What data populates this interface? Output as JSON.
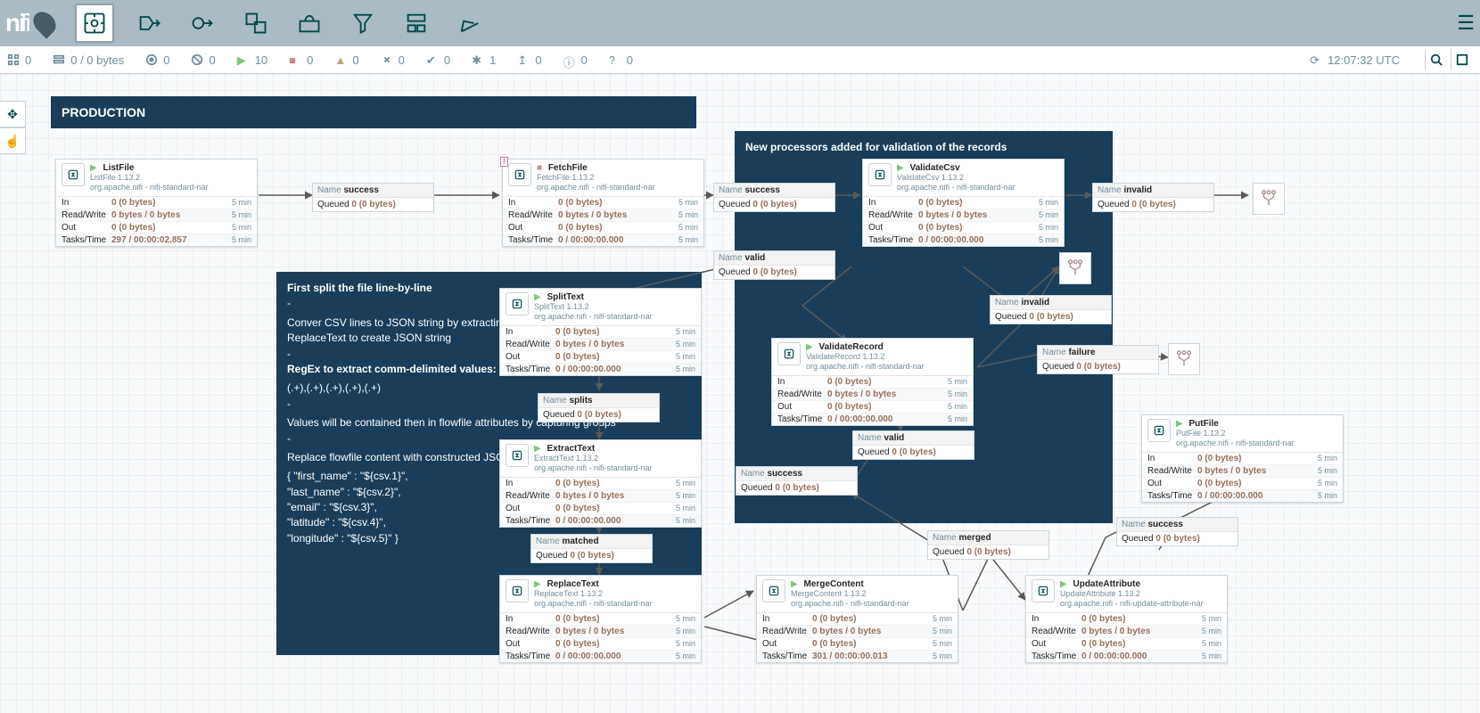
{
  "app": {
    "logo": "ni",
    "logo2": "fi"
  },
  "status": {
    "threads": "0",
    "queued": "0 / 0 bytes",
    "tx_in": "0",
    "tx_out": "0",
    "running": "10",
    "stopped": "0",
    "invalid": "0",
    "disabled": "0",
    "uptodate": "0",
    "stale": "1",
    "sync": "0",
    "info": "0",
    "unknown": "0",
    "clock": "12:07:32 UTC"
  },
  "groups": {
    "production": "PRODUCTION",
    "validation_title": "New processors added for validation of the records",
    "split_title": "First split the file line-by-line",
    "split_body1": "Conver CSV lines to JSON string by extracting CSV values using RegEx and then ReplaceText to create JSON string",
    "split_body2": "RegEx to extract comm-delimited values:",
    "split_regex": "(.+),(.+),(.+),(.+),(.+)",
    "split_body3": "Values will be contained then in flowfile attributes by capturing groups",
    "split_body4": "Replace flowfile content with constructed JSON string and attributes values",
    "split_json": "{ \"first_name\" : \"${csv.1}\",\n\"last_name\" : \"${csv.2}\",\n\"email\" : \"${csv.3}\",\n\"latitude\" : \"${csv.4}\",\n\"longitude\" : \"${csv.5}\" }"
  },
  "five_min": "5 min",
  "queued_zero": "0 (0 bytes)",
  "proc": {
    "listfile": {
      "name": "ListFile",
      "type": "ListFile 1.13.2",
      "bundle": "org.apache.nifi - nifi-standard-nar",
      "state": "run",
      "in": "0 (0 bytes)",
      "rw": "0 bytes / 0 bytes",
      "out": "0 (0 bytes)",
      "tt": "297 / 00:00:02.857"
    },
    "fetchfile": {
      "name": "FetchFile",
      "type": "FetchFile 1.13.2",
      "bundle": "org.apache.nifi - nifi-standard-nar",
      "state": "stop",
      "in": "0 (0 bytes)",
      "rw": "0 bytes / 0 bytes",
      "out": "0 (0 bytes)",
      "tt": "0 / 00:00:00.000"
    },
    "validatecsv": {
      "name": "ValidateCsv",
      "type": "ValidateCsv 1.13.2",
      "bundle": "org.apache.nifi - nifi-standard-nar",
      "state": "run",
      "in": "0 (0 bytes)",
      "rw": "0 bytes / 0 bytes",
      "out": "0 (0 bytes)",
      "tt": "0 / 00:00:00.000"
    },
    "splittext": {
      "name": "SplitText",
      "type": "SplitText 1.13.2",
      "bundle": "org.apache.nifi - nifi-standard-nar",
      "state": "run",
      "in": "0 (0 bytes)",
      "rw": "0 bytes / 0 bytes",
      "out": "0 (0 bytes)",
      "tt": "0 / 00:00:00.000"
    },
    "extracttext": {
      "name": "ExtractText",
      "type": "ExtractText 1.13.2",
      "bundle": "org.apache.nifi - nifi-standard-nar",
      "state": "run",
      "in": "0 (0 bytes)",
      "rw": "0 bytes / 0 bytes",
      "out": "0 (0 bytes)",
      "tt": "0 / 00:00:00.000"
    },
    "replacetext": {
      "name": "ReplaceText",
      "type": "ReplaceText 1.13.2",
      "bundle": "org.apache.nifi - nifi-standard-nar",
      "state": "run",
      "in": "0 (0 bytes)",
      "rw": "0 bytes / 0 bytes",
      "out": "0 (0 bytes)",
      "tt": "0 / 00:00:00.000"
    },
    "validaterec": {
      "name": "ValidateRecord",
      "type": "ValidateRecord 1.13.2",
      "bundle": "org.apache.nifi - nifi-standard-nar",
      "state": "run",
      "in": "0 (0 bytes)",
      "rw": "0 bytes / 0 bytes",
      "out": "0 (0 bytes)",
      "tt": "0 / 00:00:00.000"
    },
    "mergecontent": {
      "name": "MergeContent",
      "type": "MergeContent 1.13.2",
      "bundle": "org.apache.nifi - nifi-standard-nar",
      "state": "run",
      "in": "0 (0 bytes)",
      "rw": "0 bytes / 0 bytes",
      "out": "0 (0 bytes)",
      "tt": "301 / 00:00:00.013"
    },
    "updateattr": {
      "name": "UpdateAttribute",
      "type": "UpdateAttribute 1.13.2",
      "bundle": "org.apache.nifi - nifi-update-attribute-nar",
      "state": "run",
      "in": "0 (0 bytes)",
      "rw": "0 bytes / 0 bytes",
      "out": "0 (0 bytes)",
      "tt": "0 / 00:00:00.000"
    },
    "putfile": {
      "name": "PutFile",
      "type": "PutFile 1.13.2",
      "bundle": "org.apache.nifi - nifi-standard-nar",
      "state": "run",
      "in": "0 (0 bytes)",
      "rw": "0 bytes / 0 bytes",
      "out": "0 (0 bytes)",
      "tt": "0 / 00:00:00.000"
    }
  },
  "conn": {
    "success": "success",
    "splits": "splits",
    "matched": "matched",
    "valid": "valid",
    "invalid": "invalid",
    "failure": "failure",
    "merged": "merged",
    "name": "Name",
    "queued": "Queued"
  }
}
